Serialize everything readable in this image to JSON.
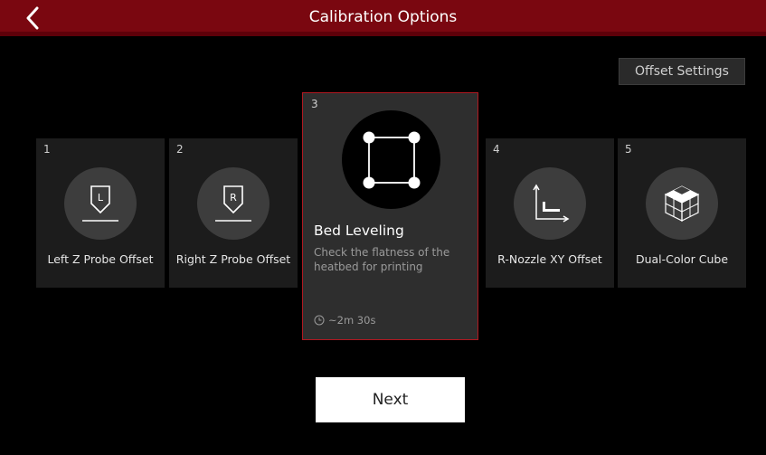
{
  "header": {
    "title": "Calibration Options"
  },
  "toolbar": {
    "offset_settings_label": "Offset Settings"
  },
  "cards": [
    {
      "number": "1",
      "label": "Left Z Probe Offset"
    },
    {
      "number": "2",
      "label": "Right Z Probe Offset"
    },
    {
      "number": "3",
      "label": "Bed Leveling",
      "description": "Check the flatness of the heatbed for printing",
      "time": "~2m 30s",
      "selected": true
    },
    {
      "number": "4",
      "label": "R-Nozzle XY Offset"
    },
    {
      "number": "5",
      "label": "Dual-Color Cube"
    }
  ],
  "icons": {
    "back": "chevron-left-icon",
    "card1": "left-probe-icon",
    "card2": "right-probe-icon",
    "card3": "bed-leveling-icon",
    "card4": "xy-offset-icon",
    "card5": "cube-icon",
    "time": "clock-icon"
  },
  "footer": {
    "next_label": "Next"
  },
  "colors": {
    "header": "#7a0710",
    "selected_border": "#b01820",
    "card_bg": "#1c1c1c",
    "selected_bg": "#2e2e2e"
  }
}
